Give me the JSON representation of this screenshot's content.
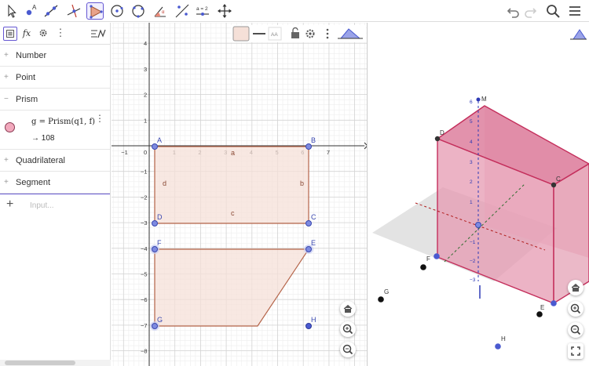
{
  "toolbar": {
    "tools": [
      "move-tool",
      "point-tool",
      "line-tool",
      "perpendicular-line-tool",
      "polygon-tool",
      "circle-tool",
      "circle-through-points-tool",
      "angle-tool",
      "reflect-tool",
      "slider-tool",
      "move-graphics-tool"
    ],
    "active_tool": "polygon-tool",
    "right": [
      "undo",
      "redo",
      "search",
      "menu"
    ]
  },
  "algebra": {
    "categories": [
      "Number",
      "Point",
      "Prism",
      "Quadrilateral",
      "Segment"
    ],
    "prism_item": {
      "definition": "g = Prism(q1, f)",
      "value": "→  108",
      "color": "#f2a9bd"
    },
    "input_placeholder": "Input..."
  },
  "graphics2d": {
    "x_ticks": [
      "−1",
      "0",
      "1",
      "2",
      "3",
      "4",
      "5",
      "6",
      "7"
    ],
    "y_ticks": [
      "4",
      "3",
      "2",
      "1",
      "−1",
      "−2",
      "−3",
      "−4",
      "−5",
      "−6",
      "−7",
      "−8"
    ],
    "points": [
      "A",
      "B",
      "C",
      "D",
      "E",
      "F",
      "G",
      "H"
    ],
    "edge_labels": [
      "a",
      "b",
      "c",
      "d"
    ],
    "polygon_fill": "#f5e0d8",
    "polygon_stroke": "#b5654a",
    "point_color": "#5a6ad8"
  },
  "graphics3d": {
    "points": [
      "M",
      "D",
      "C",
      "F",
      "E",
      "G",
      "H"
    ],
    "prism_fill": "#e58aa5",
    "prism_edge": "#c42f5c",
    "axis_ticks": [
      "6",
      "5",
      "4",
      "3",
      "2",
      "1",
      "−1",
      "−2",
      "−3"
    ]
  },
  "style_bar": {
    "text_size": "AA"
  }
}
